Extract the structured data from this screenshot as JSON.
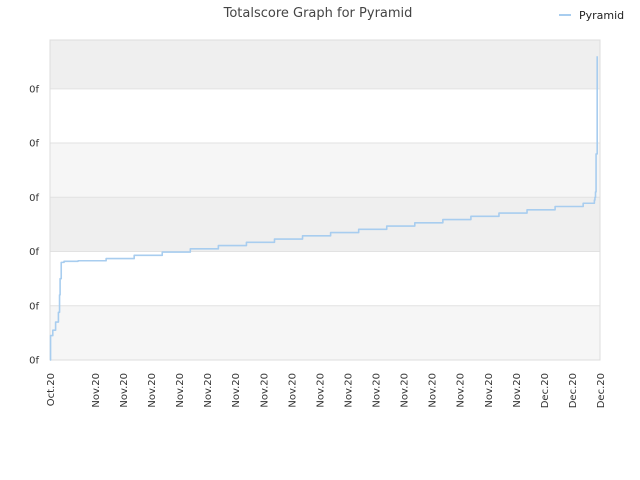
{
  "chart_data": {
    "type": "line",
    "title": "Totalscore Graph for Pyramid",
    "xlabel": "",
    "ylabel": "",
    "legend_position": "top-right",
    "grid": true,
    "band_colors": [
      "#efefef",
      "#ffffff",
      "#f6f6f6"
    ],
    "y_tick_labels": [
      "0f",
      "0f",
      "0f",
      "0f",
      "0f",
      "0f"
    ],
    "x_tick_labels": [
      "Oct.20",
      "Nov.20",
      "Nov.20",
      "Nov.20",
      "Nov.20",
      "Nov.20",
      "Nov.20",
      "Nov.20",
      "Nov.20",
      "Nov.20",
      "Nov.20",
      "Nov.20",
      "Nov.20",
      "Nov.20",
      "Nov.20",
      "Nov.20",
      "Nov.20",
      "Dec.20",
      "Dec.20",
      "Dec.20"
    ],
    "x_tick_positions": [
      0,
      1.6,
      2.6,
      3.6,
      4.6,
      5.6,
      6.6,
      7.6,
      8.6,
      9.6,
      10.6,
      11.6,
      12.6,
      13.6,
      14.6,
      15.6,
      16.6,
      17.6,
      18.6,
      19.6
    ],
    "xlim": [
      0,
      19.6
    ],
    "ylim": [
      0,
      5.9
    ],
    "series": [
      {
        "name": "Pyramid",
        "color": "#a8cdef",
        "x": [
          0,
          0.02,
          0.1,
          0.2,
          0.3,
          0.34,
          0.36,
          0.4,
          0.5,
          1.0,
          2.0,
          3.0,
          4.0,
          5.0,
          6.0,
          7.0,
          8.0,
          9.0,
          10.0,
          11.0,
          12.0,
          13.0,
          14.0,
          15.0,
          16.0,
          17.0,
          18.0,
          19.0,
          19.4,
          19.42,
          19.44,
          19.46,
          19.5
        ],
        "y": [
          0,
          0.45,
          0.55,
          0.7,
          0.88,
          1.2,
          1.5,
          1.8,
          1.82,
          1.83,
          1.87,
          1.93,
          1.99,
          2.05,
          2.11,
          2.17,
          2.23,
          2.29,
          2.35,
          2.41,
          2.47,
          2.53,
          2.59,
          2.65,
          2.71,
          2.77,
          2.83,
          2.89,
          2.95,
          3.0,
          3.1,
          3.8,
          5.6
        ]
      }
    ]
  }
}
